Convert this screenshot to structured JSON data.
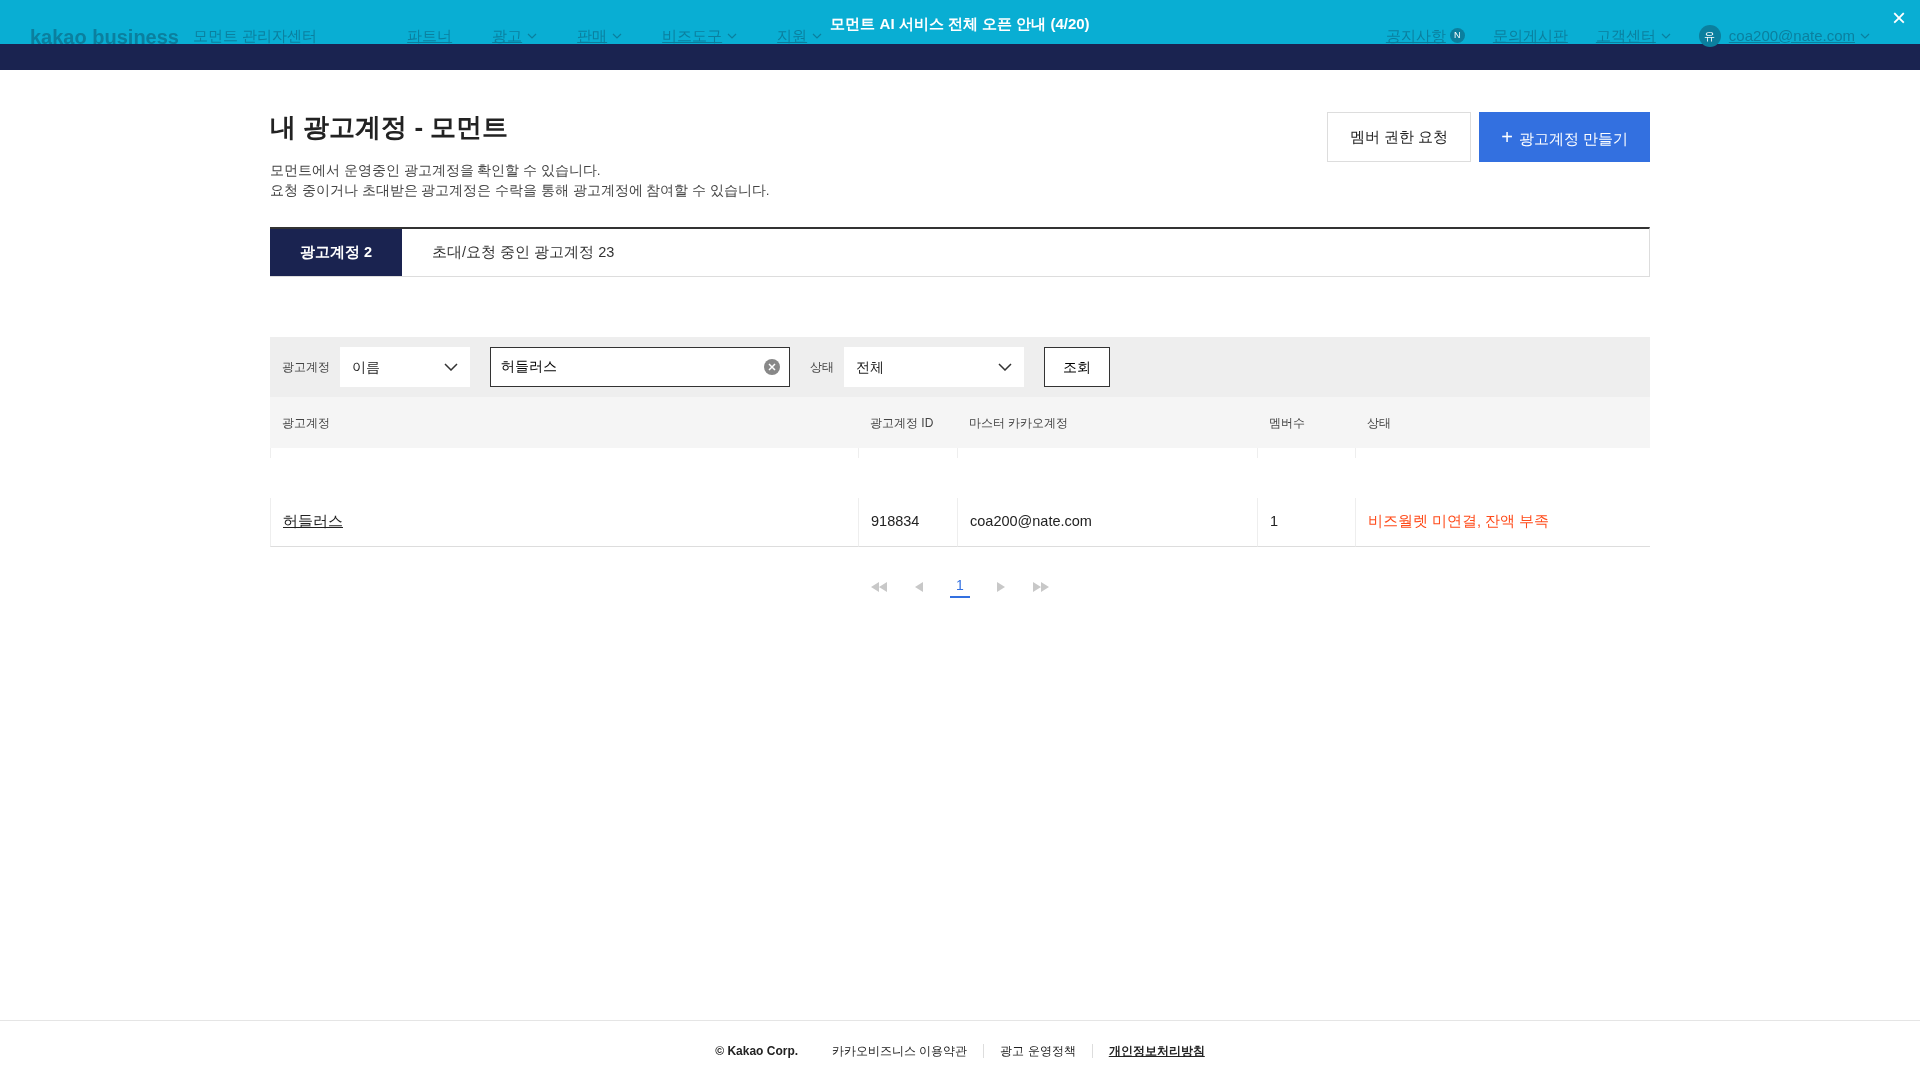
{
  "banner": {
    "text": "모먼트 AI 서비스 전체 오픈 안내 (4/20)",
    "close": "×"
  },
  "header": {
    "logo": "kakao business",
    "subtitle": "모먼트 관리자센터",
    "nav": [
      {
        "label": "파트너",
        "dropdown": false
      },
      {
        "label": "광고",
        "dropdown": true
      },
      {
        "label": "판매",
        "dropdown": true
      },
      {
        "label": "비즈도구",
        "dropdown": true
      },
      {
        "label": "지원",
        "dropdown": true
      }
    ],
    "right": [
      {
        "label": "공지사항",
        "kind": "badge",
        "badge": "N"
      },
      {
        "label": "문의게시판",
        "kind": "plain"
      },
      {
        "label": "고객센터",
        "kind": "dropdown"
      }
    ],
    "user": {
      "avatar": "유",
      "email": "coa200@nate.com"
    }
  },
  "page": {
    "title": "내 광고계정 - 모먼트",
    "description": [
      "모먼트에서 운영중인 광고계정을 확인할 수 있습니다.",
      "요청 중이거나 초대받은 광고계정은 수락을 통해 광고계정에 참여할 수 있습니다."
    ],
    "buttons": [
      {
        "label": "멤버 권한 요청",
        "kind": "outline"
      },
      {
        "label": "광고계정 만들기",
        "kind": "primary",
        "icon": "+"
      }
    ]
  },
  "tabs": [
    {
      "label": "광고계정 2",
      "selected": true
    },
    {
      "label": "초대/요청 중인 광고계정 23",
      "selected": false
    }
  ],
  "filter": {
    "account_label": "광고계정",
    "account_type": "이름",
    "search_value": "허들러스",
    "status_label": "상태",
    "status_value": "전체",
    "submit": "조회"
  },
  "table": {
    "columns": [
      "광고계정",
      "광고계정 ID",
      "마스터 카카오계정",
      "멤버수",
      "상태"
    ],
    "rows": [
      {
        "name": "허들러스",
        "id": "918834",
        "master": "coa200@nate.com",
        "members": "1",
        "status": "비즈월렛 미연결, 잔액 부족",
        "warning": true
      }
    ]
  },
  "pagination": {
    "pages": [
      {
        "label": "1",
        "selected": true
      }
    ]
  },
  "footer": [
    {
      "label": "© Kakao Corp.",
      "bold": true
    },
    {
      "label": "카카오비즈니스 이용약관",
      "bold": false
    },
    {
      "label": "광고 운영정책",
      "bold": false
    },
    {
      "label": "개인정보처리방침",
      "bold": true
    }
  ]
}
